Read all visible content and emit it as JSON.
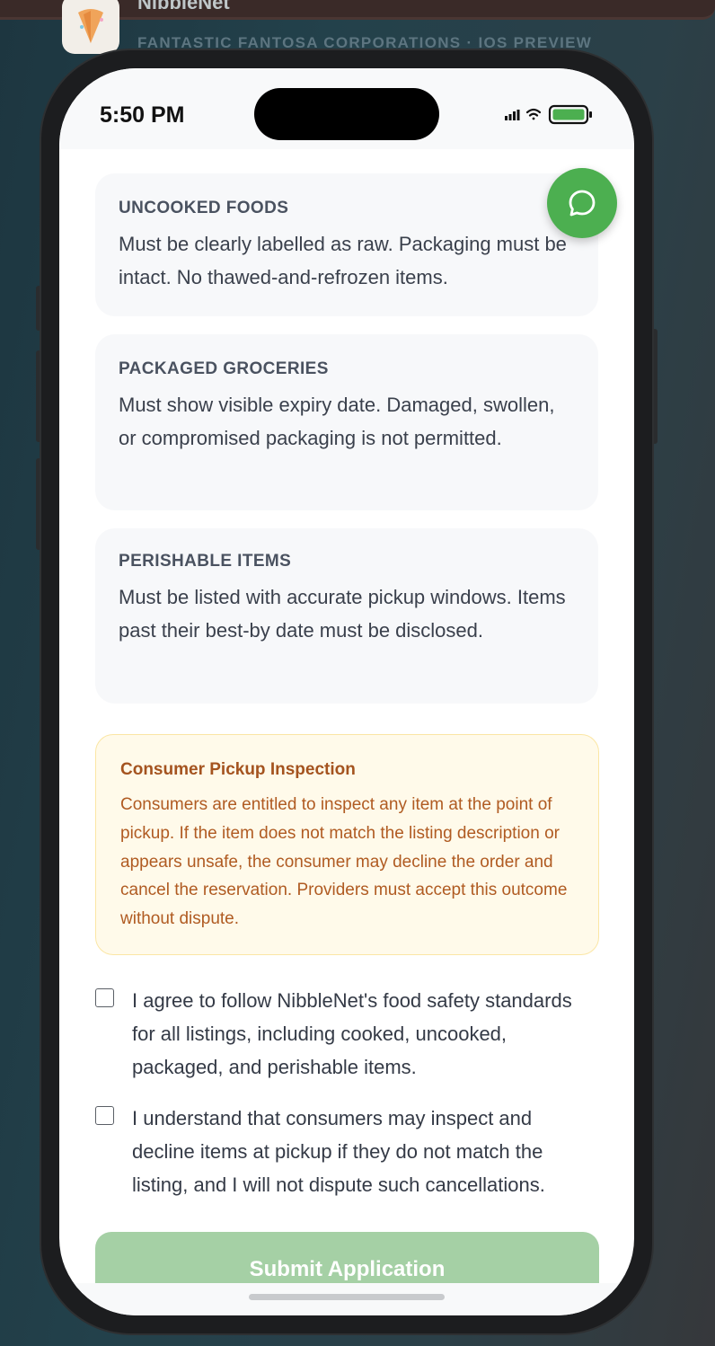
{
  "header": {
    "app_name": "NibbleNet",
    "subtitle": "FANTASTIC FANTOSA CORPORATIONS · IOS PREVIEW"
  },
  "status_bar": {
    "time": "5:50 PM"
  },
  "cards": [
    {
      "title": "UNCOOKED FOODS",
      "text": "Must be clearly labelled as raw. Packaging must be intact. No thawed-and-refrozen items."
    },
    {
      "title": "PACKAGED GROCERIES",
      "text": "Must show visible expiry date. Damaged, swollen, or compromised packaging is not permitted."
    },
    {
      "title": "PERISHABLE ITEMS",
      "text": "Must be listed with accurate pickup windows. Items past their best-by date must be disclosed."
    }
  ],
  "notice": {
    "title": "Consumer Pickup Inspection",
    "text": "Consumers are entitled to inspect any item at the point of pickup. If the item does not match the listing description or appears unsafe, the consumer may decline the order and cancel the reservation. Providers must accept this outcome without dispute."
  },
  "agreements": [
    {
      "text": "I agree to follow NibbleNet's food safety standards for all listings, including cooked, uncooked, packaged, and perishable items.",
      "checked": false
    },
    {
      "text": "I understand that consumers may inspect and decline items at pickup if they do not match the listing, and I will not dispute such cancellations.",
      "checked": false
    }
  ],
  "submit_label": "Submit Application",
  "colors": {
    "accent": "#4caf50",
    "submit_disabled": "#a5d0a5",
    "notice_bg": "#fffaea",
    "notice_text": "#b05b22"
  },
  "icons": {
    "chat": "chat-bubble-icon",
    "signal": "signal-icon",
    "wifi": "wifi-icon",
    "battery": "battery-icon",
    "app": "app-logo-icon"
  }
}
